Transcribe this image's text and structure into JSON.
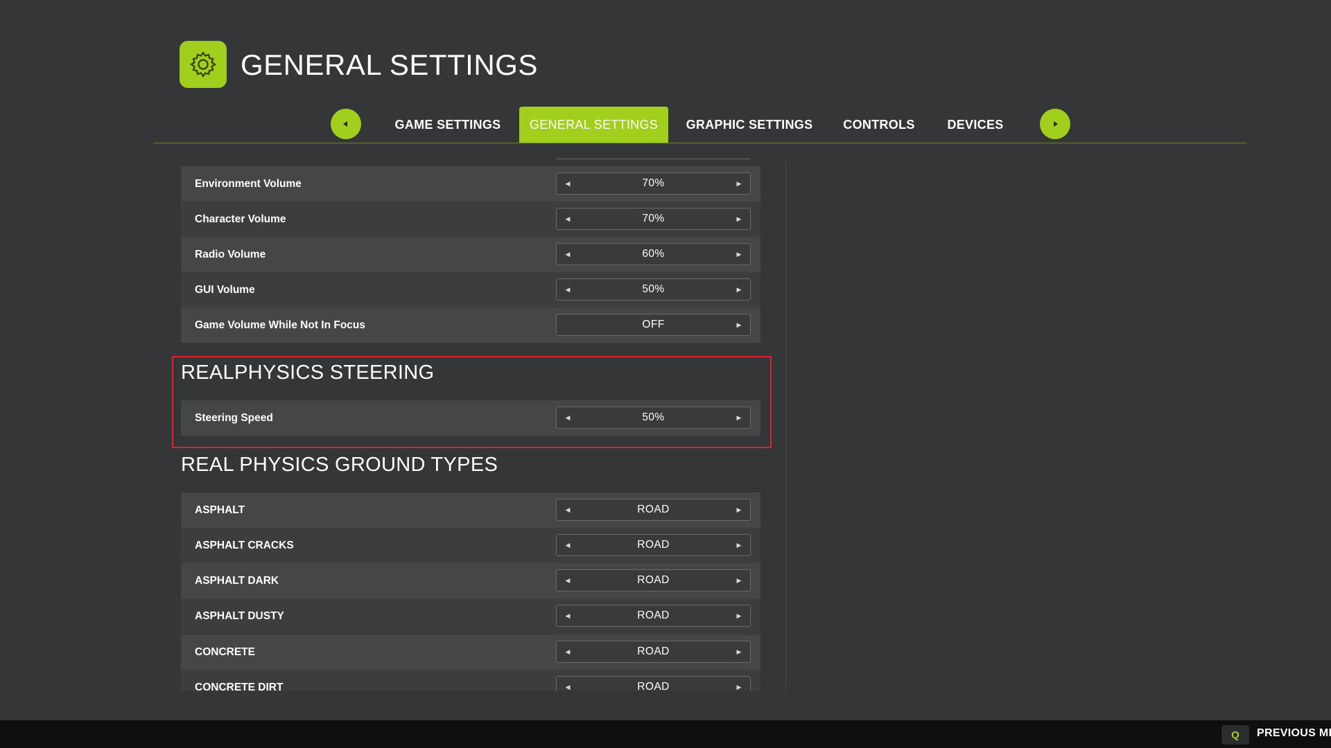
{
  "header": {
    "title": "GENERAL SETTINGS",
    "icon": "gear-icon"
  },
  "tabs": [
    {
      "label": "GAME SETTINGS",
      "active": false
    },
    {
      "label": "GENERAL SETTINGS",
      "active": true
    },
    {
      "label": "GRAPHIC SETTINGS",
      "active": false
    },
    {
      "label": "CONTROLS",
      "active": false
    },
    {
      "label": "DEVICES",
      "active": false
    }
  ],
  "audio_rows": [
    {
      "label": "Environment Volume",
      "value": "70%",
      "has_left_arrow": true
    },
    {
      "label": "Character Volume",
      "value": "70%",
      "has_left_arrow": true
    },
    {
      "label": "Radio Volume",
      "value": "60%",
      "has_left_arrow": true
    },
    {
      "label": "GUI Volume",
      "value": "50%",
      "has_left_arrow": true
    },
    {
      "label": "Game Volume While Not In Focus",
      "value": "OFF",
      "has_left_arrow": false
    }
  ],
  "sections": {
    "steering": {
      "title": "REALPHYSICS STEERING",
      "rows": [
        {
          "label": "Steering Speed",
          "value": "50%"
        }
      ]
    },
    "ground_types": {
      "title": "REAL PHYSICS GROUND TYPES",
      "rows": [
        {
          "label": "ASPHALT",
          "value": "ROAD"
        },
        {
          "label": "ASPHALT CRACKS",
          "value": "ROAD"
        },
        {
          "label": "ASPHALT DARK",
          "value": "ROAD"
        },
        {
          "label": "ASPHALT DUSTY",
          "value": "ROAD"
        },
        {
          "label": "CONCRETE",
          "value": "ROAD"
        },
        {
          "label": "CONCRETE DIRT",
          "value": "ROAD"
        }
      ]
    }
  },
  "footer": {
    "key": "Q",
    "action_label": "PREVIOUS ME"
  },
  "colors": {
    "accent": "#a2cf1d",
    "background": "#353637",
    "highlight": "#e0202a"
  }
}
